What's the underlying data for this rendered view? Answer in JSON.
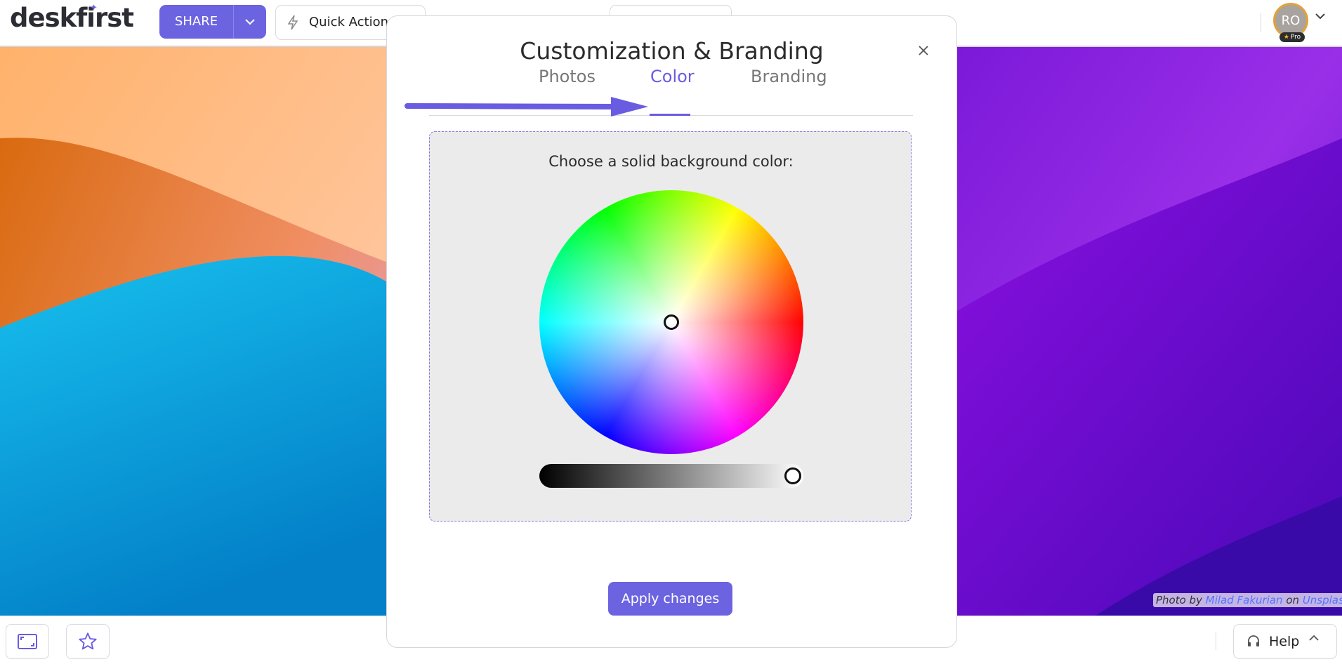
{
  "app": {
    "logo_text": "deskfirst"
  },
  "header": {
    "share_label": "SHARE",
    "quick_actions_label": "Quick Actions",
    "avatar_initials": "RO",
    "pro_badge": "Pro"
  },
  "modal": {
    "title": "Customization & Branding",
    "tabs": [
      {
        "label": "Photos",
        "active": false
      },
      {
        "label": "Color",
        "active": true
      },
      {
        "label": "Branding",
        "active": false
      }
    ],
    "panel_label": "Choose a solid background color:",
    "selected_hue": "center (white)",
    "brightness_level": 0.98,
    "apply_label": "Apply changes"
  },
  "photo_credit": {
    "prefix": "Photo by",
    "author": "Milad Fakurian",
    "on": "on",
    "site": "Unsplash"
  },
  "footer": {
    "help_label": "Help"
  },
  "colors": {
    "accent": "#6c63e0",
    "tab_active": "#6a5ce0",
    "panel_bg": "#ebebeb"
  },
  "icons": [
    "lightning-icon",
    "chevron-down-icon",
    "close-icon",
    "arrow-annotation",
    "fullscreen-icon",
    "star-icon",
    "headset-icon",
    "chevron-up-icon"
  ]
}
